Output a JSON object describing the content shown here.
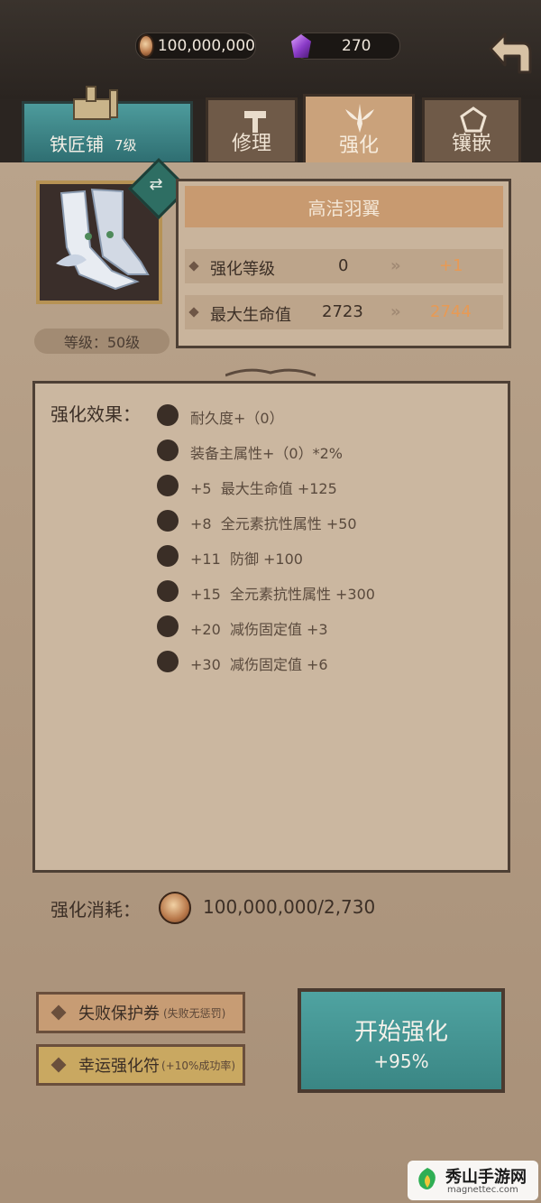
{
  "resources": {
    "coins": "100,000,000",
    "gems": "270"
  },
  "tabs": {
    "shop_name": "铁匠铺",
    "shop_level": "7级",
    "repair": "修理",
    "enhance": "强化",
    "inlay": "镶嵌"
  },
  "item": {
    "name": "高洁羽翼",
    "level_label": "等级：50级",
    "stats": [
      {
        "label": "强化等级",
        "current": "0",
        "next": "+1"
      },
      {
        "label": "最大生命值",
        "current": "2723",
        "next": "2744"
      }
    ]
  },
  "effects": {
    "title": "强化效果：",
    "list": [
      "耐久度+（0）",
      "装备主属性+（0）*2%",
      "+5  最大生命值 +125",
      "+8  全元素抗性属性 +50",
      "+11  防御 +100",
      "+15  全元素抗性属性 +300",
      "+20  减伤固定值 +3",
      "+30  减伤固定值 +6"
    ]
  },
  "cost": {
    "label": "强化消耗：",
    "value": "100,000,000/2,730"
  },
  "options": {
    "protect_label": "失败保护券",
    "protect_note": "(失败无惩罚)",
    "luck_label": "幸运强化符",
    "luck_note": "(+10%成功率)"
  },
  "start": {
    "label": "开始强化",
    "rate": "+95%"
  },
  "watermark": {
    "title": "秀山手游网",
    "url": "magnettec.com"
  },
  "colors": {
    "accent_teal": "#3a8684",
    "highlight_orange": "#e79a55",
    "panel_tan": "#b39c84"
  }
}
